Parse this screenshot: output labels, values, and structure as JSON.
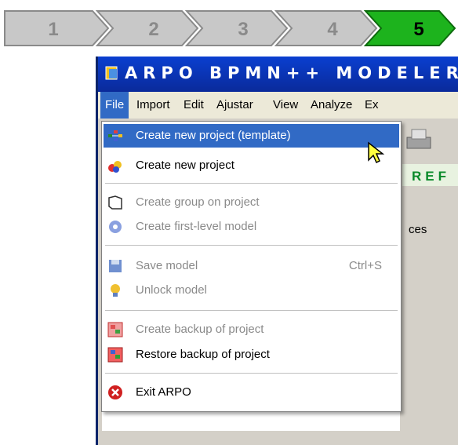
{
  "steps": [
    "1",
    "2",
    "3",
    "4",
    "5"
  ],
  "colors": {
    "step_inactive": "#c8c8c8",
    "step_active": "#1db31d",
    "title_bg": "#0a2a9a",
    "menu_highlight": "#316ac5"
  },
  "app": {
    "title": "ARPO BPMN++ MODELER"
  },
  "menubar": [
    "File",
    "Import",
    "Edit",
    "Ajustar",
    "View",
    "Analyze",
    "Ex"
  ],
  "background": {
    "repo_text": "REF",
    "ces_text": "ces"
  },
  "file_menu": {
    "items": [
      {
        "label": "Create new project (template)",
        "icon": "template-project-icon",
        "enabled": true,
        "highlighted": true
      },
      {
        "label": "Create new project",
        "icon": "new-project-icon",
        "enabled": true
      },
      {
        "label": "Create group on project",
        "icon": "folder-icon",
        "enabled": false
      },
      {
        "label": "Create first-level model",
        "icon": "gear-icon",
        "enabled": false
      },
      {
        "label": "Save model",
        "shortcut": "Ctrl+S",
        "icon": "floppy-icon",
        "enabled": false
      },
      {
        "label": "Unlock model",
        "icon": "lightbulb-icon",
        "enabled": false
      },
      {
        "label": "Create backup of project",
        "icon": "backup-icon",
        "enabled": false
      },
      {
        "label": "Restore backup of project",
        "icon": "restore-icon",
        "enabled": true
      },
      {
        "label": "Exit ARPO",
        "icon": "exit-icon",
        "enabled": true
      }
    ]
  }
}
